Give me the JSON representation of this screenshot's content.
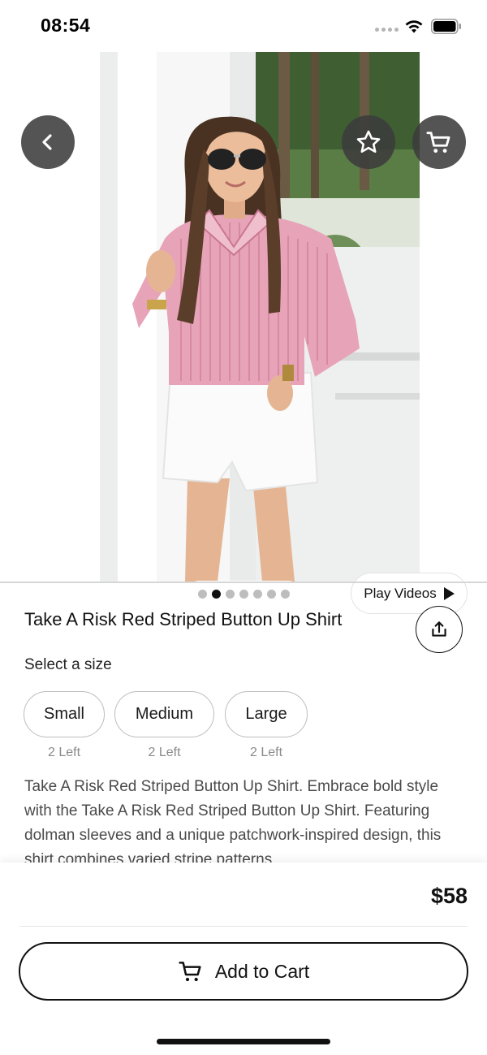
{
  "status_bar": {
    "time": "08:54"
  },
  "hero": {
    "icons": {
      "back": "chevron-left-icon",
      "favorite": "star-icon",
      "cart": "cart-icon"
    },
    "pager": {
      "count": 7,
      "active_index": 1
    },
    "play_videos_label": "Play Videos"
  },
  "product": {
    "title": "Take A Risk Red Striped Button Up Shirt",
    "select_size_label": "Select a size",
    "sizes": [
      {
        "label": "Small",
        "stock": "2 Left"
      },
      {
        "label": "Medium",
        "stock": "2 Left"
      },
      {
        "label": "Large",
        "stock": "2 Left"
      }
    ],
    "description": "Take A Risk Red Striped Button Up Shirt. Embrace bold style with the Take A Risk Red Striped Button Up Shirt. Featuring dolman sleeves and a unique patchwork-inspired design, this shirt combines varied stripe patterns"
  },
  "purchase": {
    "price": "$58",
    "add_to_cart_label": "Add to Cart"
  },
  "colors": {
    "shirt_pink": "#e7a3b8",
    "dark_button": "#3c3c3c",
    "accent": "#111111"
  }
}
